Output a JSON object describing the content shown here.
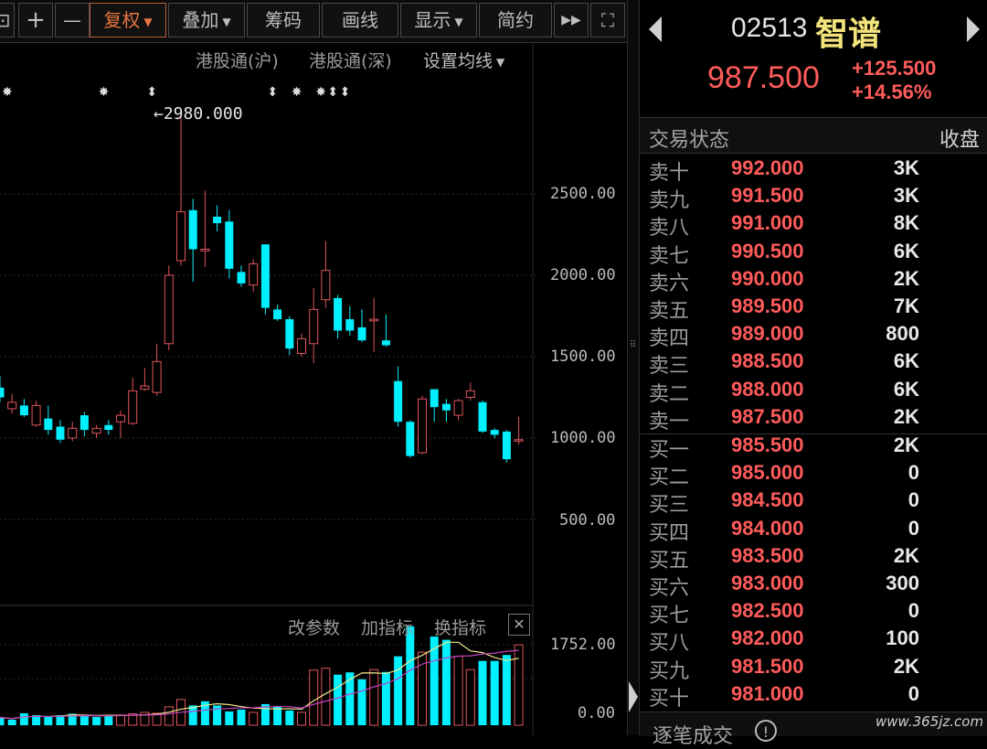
{
  "toolbar": {
    "buttons": [
      "复权",
      "叠加",
      "筹码",
      "画线",
      "显示",
      "简约"
    ],
    "plus": "+",
    "minus": "—",
    "play_glyph": "▶▶",
    "expand_glyph": "⛶"
  },
  "chart": {
    "links": [
      "港股通(沪)",
      "港股通(深)"
    ],
    "ma_setting": "设置均线",
    "max_label": "2980.000",
    "y_labels": [
      "2500.00",
      "2000.00",
      "1500.00",
      "1000.00",
      "500.00"
    ],
    "volume_y_labels": [
      "1752.00",
      "0.00"
    ],
    "indicator_controls": [
      "改参数",
      "加指标",
      "换指标"
    ],
    "close_glyph": "✕"
  },
  "chart_data": {
    "type": "candlestick",
    "ylim": [
      350,
      3100
    ],
    "candles": [
      {
        "o": 1310,
        "c": 1250,
        "h": 1380,
        "l": 1220
      },
      {
        "o": 1180,
        "c": 1220,
        "h": 1270,
        "l": 1150
      },
      {
        "o": 1200,
        "c": 1140,
        "h": 1240,
        "l": 1130
      },
      {
        "o": 1080,
        "c": 1200,
        "h": 1230,
        "l": 1070
      },
      {
        "o": 1120,
        "c": 1050,
        "h": 1200,
        "l": 1020
      },
      {
        "o": 1070,
        "c": 990,
        "h": 1110,
        "l": 970
      },
      {
        "o": 1000,
        "c": 1060,
        "h": 1100,
        "l": 980
      },
      {
        "o": 1140,
        "c": 1050,
        "h": 1160,
        "l": 1010
      },
      {
        "o": 1030,
        "c": 1060,
        "h": 1080,
        "l": 1000
      },
      {
        "o": 1080,
        "c": 1050,
        "h": 1110,
        "l": 1020
      },
      {
        "o": 1100,
        "c": 1140,
        "h": 1170,
        "l": 1000
      },
      {
        "o": 1090,
        "c": 1290,
        "h": 1370,
        "l": 1080
      },
      {
        "o": 1300,
        "c": 1320,
        "h": 1430,
        "l": 1290
      },
      {
        "o": 1280,
        "c": 1470,
        "h": 1580,
        "l": 1260
      },
      {
        "o": 1580,
        "c": 2000,
        "h": 2060,
        "l": 1540
      },
      {
        "o": 2090,
        "c": 2390,
        "h": 2980,
        "l": 2060
      },
      {
        "o": 2400,
        "c": 2160,
        "h": 2470,
        "l": 1960
      },
      {
        "o": 2150,
        "c": 2160,
        "h": 2520,
        "l": 2050
      },
      {
        "o": 2360,
        "c": 2320,
        "h": 2430,
        "l": 2270
      },
      {
        "o": 2330,
        "c": 2040,
        "h": 2400,
        "l": 1980
      },
      {
        "o": 2020,
        "c": 1950,
        "h": 2060,
        "l": 1930
      },
      {
        "o": 1940,
        "c": 2070,
        "h": 2100,
        "l": 1900
      },
      {
        "o": 2190,
        "c": 1800,
        "h": 2190,
        "l": 1760
      },
      {
        "o": 1790,
        "c": 1730,
        "h": 1820,
        "l": 1720
      },
      {
        "o": 1730,
        "c": 1550,
        "h": 1750,
        "l": 1510
      },
      {
        "o": 1520,
        "c": 1610,
        "h": 1640,
        "l": 1500
      },
      {
        "o": 1580,
        "c": 1790,
        "h": 1920,
        "l": 1460
      },
      {
        "o": 1850,
        "c": 2030,
        "h": 2210,
        "l": 1800
      },
      {
        "o": 1860,
        "c": 1660,
        "h": 1880,
        "l": 1610
      },
      {
        "o": 1730,
        "c": 1660,
        "h": 1810,
        "l": 1630
      },
      {
        "o": 1680,
        "c": 1600,
        "h": 1790,
        "l": 1590
      },
      {
        "o": 1720,
        "c": 1730,
        "h": 1860,
        "l": 1530
      },
      {
        "o": 1600,
        "c": 1570,
        "h": 1760,
        "l": 1560
      },
      {
        "o": 1350,
        "c": 1100,
        "h": 1440,
        "l": 1070
      },
      {
        "o": 1100,
        "c": 890,
        "h": 1110,
        "l": 880
      },
      {
        "o": 910,
        "c": 1240,
        "h": 1260,
        "l": 900
      },
      {
        "o": 1300,
        "c": 1190,
        "h": 1300,
        "l": 1100
      },
      {
        "o": 1210,
        "c": 1170,
        "h": 1240,
        "l": 1100
      },
      {
        "o": 1140,
        "c": 1230,
        "h": 1240,
        "l": 1110
      },
      {
        "o": 1250,
        "c": 1290,
        "h": 1340,
        "l": 1230
      },
      {
        "o": 1220,
        "c": 1040,
        "h": 1230,
        "l": 1030
      },
      {
        "o": 1050,
        "c": 1020,
        "h": 1060,
        "l": 1000
      },
      {
        "o": 1040,
        "c": 870,
        "h": 1050,
        "l": 850
      },
      {
        "o": 990,
        "c": 990,
        "h": 1130,
        "l": 960
      }
    ],
    "volume_ylim": [
      0,
      1752
    ],
    "volume": [
      170,
      120,
      260,
      220,
      180,
      220,
      250,
      230,
      180,
      200,
      220,
      250,
      280,
      260,
      400,
      560,
      430,
      520,
      430,
      300,
      340,
      280,
      460,
      400,
      320,
      280,
      1200,
      1240,
      1100,
      1150,
      1000,
      1210,
      1160,
      1500,
      2150,
      1590,
      1930,
      1860,
      1500,
      1210,
      1400,
      1400,
      1530,
      1750
    ],
    "volume_up": [
      false,
      false,
      false,
      false,
      false,
      false,
      false,
      false,
      false,
      false,
      true,
      true,
      true,
      true,
      true,
      true,
      false,
      false,
      false,
      false,
      false,
      true,
      false,
      false,
      false,
      true,
      true,
      true,
      false,
      false,
      false,
      true,
      false,
      false,
      false,
      true,
      false,
      false,
      true,
      true,
      false,
      false,
      false,
      true
    ]
  },
  "quote": {
    "code": "02513",
    "name": "智谱",
    "price": "987.500",
    "change": "+125.500",
    "change_pct": "+14.56%",
    "status_label": "交易状态",
    "status_value": "收盘",
    "ticks_label": "逐笔成交",
    "ticks_icon_char": "!"
  },
  "order_book": {
    "asks": [
      {
        "label": "卖十",
        "price": "992.000",
        "vol": "3K"
      },
      {
        "label": "卖九",
        "price": "991.500",
        "vol": "3K"
      },
      {
        "label": "卖八",
        "price": "991.000",
        "vol": "8K"
      },
      {
        "label": "卖七",
        "price": "990.500",
        "vol": "6K"
      },
      {
        "label": "卖六",
        "price": "990.000",
        "vol": "2K"
      },
      {
        "label": "卖五",
        "price": "989.500",
        "vol": "7K"
      },
      {
        "label": "卖四",
        "price": "989.000",
        "vol": "800"
      },
      {
        "label": "卖三",
        "price": "988.500",
        "vol": "6K"
      },
      {
        "label": "卖二",
        "price": "988.000",
        "vol": "6K"
      },
      {
        "label": "卖一",
        "price": "987.500",
        "vol": "2K"
      }
    ],
    "bids": [
      {
        "label": "买一",
        "price": "985.500",
        "vol": "2K"
      },
      {
        "label": "买二",
        "price": "985.000",
        "vol": "0"
      },
      {
        "label": "买三",
        "price": "984.500",
        "vol": "0"
      },
      {
        "label": "买四",
        "price": "984.000",
        "vol": "0"
      },
      {
        "label": "买五",
        "price": "983.500",
        "vol": "2K"
      },
      {
        "label": "买六",
        "price": "983.000",
        "vol": "300"
      },
      {
        "label": "买七",
        "price": "982.500",
        "vol": "0"
      },
      {
        "label": "买八",
        "price": "982.000",
        "vol": "100"
      },
      {
        "label": "买九",
        "price": "981.500",
        "vol": "2K"
      },
      {
        "label": "买十",
        "price": "981.000",
        "vol": "0"
      }
    ]
  },
  "watermark": "www.365jz.com",
  "colors": {
    "up": "#e0555b",
    "down": "#00f0ff",
    "price_red": "#ff5b5b",
    "accent": "#e8743f",
    "name_yellow": "#f2e37a",
    "ma5": "#f0e68c",
    "ma10": "#c040c0"
  }
}
